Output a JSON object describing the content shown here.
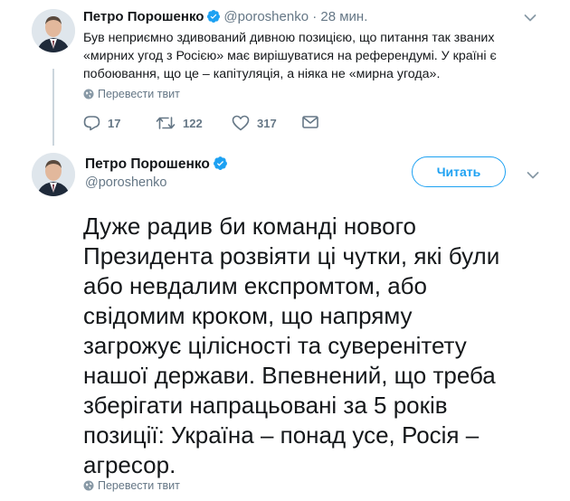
{
  "tweet1": {
    "name": "Петро Порошенко",
    "handle": "@poroshenko",
    "separator": "·",
    "time": "28 мин.",
    "lines": [
      "Був неприємно здивований дивною позицією, що питання так званих",
      "«мирних угод з Росією» має вирішуватися на референдумі. У країні є",
      "побоювання, що це – капітуляція, а ніяка не «мирна угода»."
    ],
    "translate_label": "Перевести твит",
    "replies": "17",
    "retweets": "122",
    "likes": "317"
  },
  "tweet2": {
    "name": "Петро Порошенко",
    "handle": "@poroshenko",
    "follow_label": "Читать",
    "lines": [
      "Дуже радив би команді нового",
      "Президента розвіяти ці чутки, які були",
      "або невдалим експромтом, або",
      "свідомим кроком, що напряму",
      "загрожує цілісності та суверенітету",
      "нашої держави. Впевнений, що треба",
      "зберігати напрацьовані за 5 років",
      "позиції: Україна – понад усе, Росія –",
      "агресор."
    ],
    "translate_label": "Перевести твит"
  },
  "colors": {
    "accent": "#1da1f2",
    "text": "#14171a",
    "secondary": "#657786",
    "thread_line": "#ccd6dd"
  },
  "icons": [
    "avatar",
    "verified-badge-icon",
    "chevron-down-icon",
    "globe-icon",
    "reply-icon",
    "retweet-icon",
    "like-icon",
    "direct-message-icon"
  ]
}
